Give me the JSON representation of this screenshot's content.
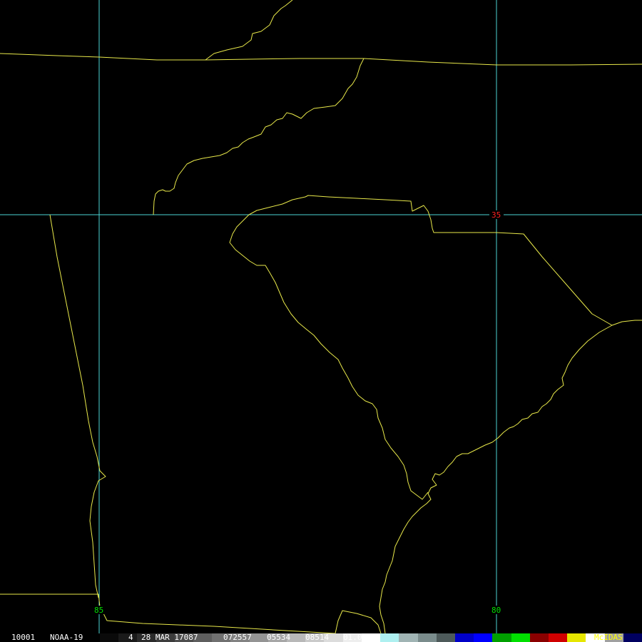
{
  "map": {
    "latitude_labels": [
      {
        "text": "35"
      }
    ],
    "longitude_labels": [
      {
        "text": "85"
      },
      {
        "text": "80"
      }
    ],
    "colors": {
      "background": "#000000",
      "grid_lines": "#4cd5d5",
      "boundaries": "#e8e84a",
      "latitude_label": "#ff2020",
      "longitude_label": "#00e000"
    }
  },
  "footer": {
    "frame_id": "10001",
    "satellite": "NOAA-19",
    "band": "4",
    "date": "28 MAR 17087",
    "time": "072557",
    "center_line": "05534",
    "center_element": "08514",
    "resolution": "01.00",
    "brand": "McIDAS",
    "colorbar_segments": [
      "#0a0a0a",
      "#1a1a1a",
      "#2b2b2b",
      "#3c3c3c",
      "#4d4d4d",
      "#5e5e5e",
      "#707070",
      "#828282",
      "#949494",
      "#a6a6a6",
      "#b8b8b8",
      "#cacaca",
      "#dcdcdc",
      "#eeeeee",
      "#ffffff",
      "#aef0f0",
      "#a0b4b4",
      "#7a8c8c",
      "#4d5a5a",
      "#0000c8",
      "#0000ff",
      "#00a000",
      "#00e000",
      "#8b0000",
      "#d00000",
      "#e6e600",
      "#ffffff",
      "#a0a0a0",
      "#000060"
    ]
  }
}
